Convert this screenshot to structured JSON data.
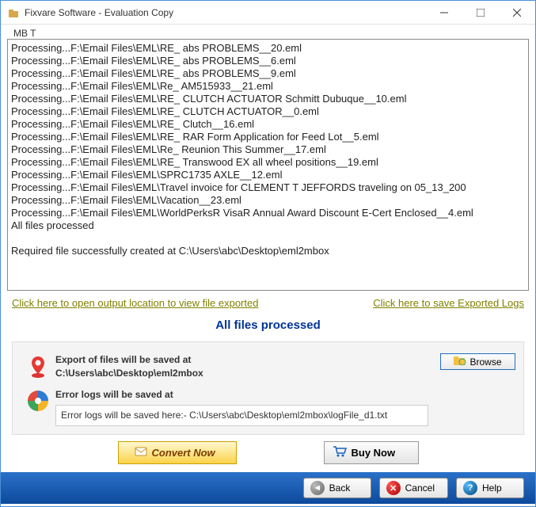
{
  "window": {
    "title": "Fixvare Software - Evaluation Copy",
    "truncated_line": "MB    T"
  },
  "log": [
    "Processing...F:\\Email Files\\EML\\RE_ abs PROBLEMS__20.eml",
    "Processing...F:\\Email Files\\EML\\RE_ abs PROBLEMS__6.eml",
    "Processing...F:\\Email Files\\EML\\RE_ abs PROBLEMS__9.eml",
    "Processing...F:\\Email Files\\EML\\Re_ AM515933__21.eml",
    "Processing...F:\\Email Files\\EML\\RE_ CLUTCH ACTUATOR Schmitt Dubuque__10.eml",
    "Processing...F:\\Email Files\\EML\\RE_ CLUTCH ACTUATOR__0.eml",
    "Processing...F:\\Email Files\\EML\\RE_ Clutch__16.eml",
    "Processing...F:\\Email Files\\EML\\RE_ RAR Form Application for Feed Lot__5.eml",
    "Processing...F:\\Email Files\\EML\\Re_ Reunion This Summer__17.eml",
    "Processing...F:\\Email Files\\EML\\RE_ Transwood EX all wheel positions__19.eml",
    "Processing...F:\\Email Files\\EML\\SPRC1735 AXLE__12.eml",
    "Processing...F:\\Email Files\\EML\\Travel invoice for CLEMENT T JEFFORDS traveling on 05_13_200",
    "Processing...F:\\Email Files\\EML\\Vacation__23.eml",
    "Processing...F:\\Email Files\\EML\\WorldPerksR VisaR Annual Award Discount E-Cert Enclosed__4.eml",
    "All files processed",
    "",
    "Required file successfully created at C:\\Users\\abc\\Desktop\\eml2mbox"
  ],
  "links": {
    "open_output": "Click here to open output location to view file exported",
    "save_logs": "Click here to save Exported Logs"
  },
  "status": "All files processed",
  "panel": {
    "export_label": "Export of files will be saved at",
    "export_path": "C:\\Users\\abc\\Desktop\\eml2mbox",
    "browse": "Browse",
    "error_label": "Error logs will be saved at",
    "error_path": "Error logs will be saved here:- C:\\Users\\abc\\Desktop\\eml2mbox\\logFile_d1.txt"
  },
  "actions": {
    "convert": "Convert Now",
    "buy": "Buy Now"
  },
  "footer": {
    "back": "Back",
    "cancel": "Cancel",
    "help": "Help"
  }
}
